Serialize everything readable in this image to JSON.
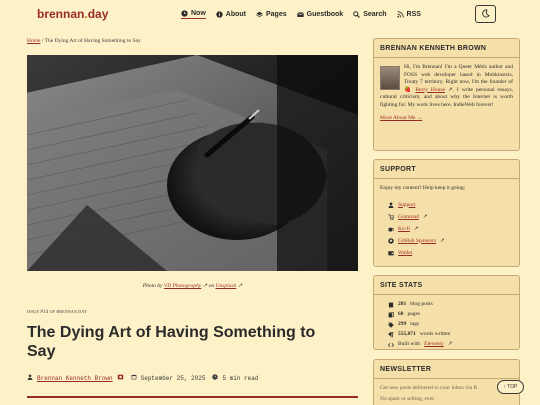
{
  "site": {
    "logo_main": "brennan",
    "logo_dot": ".",
    "logo_tld": "day"
  },
  "nav": {
    "items": [
      {
        "label": "Now",
        "icon": "clock-icon"
      },
      {
        "label": "About",
        "icon": "info-icon"
      },
      {
        "label": "Pages",
        "icon": "layers-icon"
      },
      {
        "label": "Guestbook",
        "icon": "mail-icon"
      },
      {
        "label": "Search",
        "icon": "search-icon"
      },
      {
        "label": "RSS",
        "icon": "rss-icon"
      }
    ],
    "active": "Now"
  },
  "breadcrumb": {
    "home": "Home",
    "sep": " / ",
    "current": "The Dying Art of Having Something to Say"
  },
  "post": {
    "caption_prefix": "Photo by ",
    "photographer": "VD Photography",
    "caption_mid": " on ",
    "source": "Unsplash",
    "issue_prefix": "issue ",
    "issue_num": "#14",
    "issue_suffix": " of brennan.day",
    "title": "The Dying Art of Having Something to Say",
    "author": "Brennan Kenneth Brown",
    "date": "September 25, 2025",
    "read_time": "5 min read"
  },
  "about": {
    "heading": "BRENNAN KENNETH BROWN",
    "bio_1": "Hi, I'm Brennan! I'm a Queer Métis author and FOSS web developer based in Mohkinstsis, Treaty 7 territory. Right now, I'm the founder of ",
    "bio_link": "Berry House",
    "bio_2": ". I write personal essays, cultural criticism, and about why the Internet is worth fighting for. My work lives here. IndieWeb forever!",
    "more": "More About Me →"
  },
  "support": {
    "heading": "SUPPORT",
    "intro": "Enjoy my content? Help keep it going:",
    "links": [
      {
        "label": "Support",
        "icon": "person-icon"
      },
      {
        "label": "Gumroad",
        "icon": "cart-icon"
      },
      {
        "label": "Ko-fi",
        "icon": "coffee-icon"
      },
      {
        "label": "GitHub Sponsors",
        "icon": "github-icon"
      },
      {
        "label": "Wallet",
        "icon": "wallet-icon"
      }
    ]
  },
  "stats": {
    "heading": "SITE STATS",
    "rows": [
      {
        "value": "201",
        "label": "blog posts",
        "icon": "book-icon"
      },
      {
        "value": "60",
        "label": "pages",
        "icon": "pages-icon"
      },
      {
        "value": "299",
        "label": "tags",
        "icon": "tag-icon"
      },
      {
        "value": "555,071",
        "label": "words written",
        "icon": "paragraph-icon"
      }
    ],
    "built_prefix": "Built with ",
    "built_link": "Eleventy",
    "built_icon": "code-icon"
  },
  "newsletter": {
    "heading": "NEWSLETTER",
    "line1": "Get new posts delivered to your inbox via R",
    "line2": "No spam or selling, ever."
  },
  "top_button": "↑ TOP",
  "colors": {
    "accent": "#9b2c23",
    "background": "#fdf1c7",
    "card": "#f5e0a9"
  }
}
